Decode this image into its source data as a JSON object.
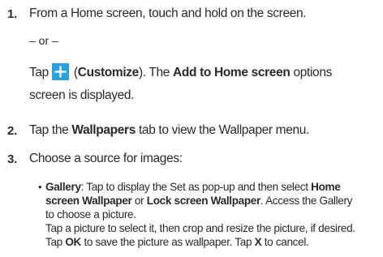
{
  "steps": [
    {
      "number": "1.",
      "line1": "From a Home screen, touch and hold on the screen.",
      "or_text": "– or –",
      "tap_prefix": "Tap",
      "icon": "plus-icon",
      "icon_color": "#2aa0dc",
      "customize_open": "(",
      "customize_label": "Customize",
      "customize_close": "). The",
      "add_to_home_label": "Add to Home screen",
      "options_text": "options",
      "line_end": "screen is displayed."
    },
    {
      "number": "2.",
      "prefix": "Tap the",
      "wallpapers_label": "Wallpapers",
      "suffix": "tab to view the Wallpaper menu."
    },
    {
      "number": "3.",
      "text": "Choose a source for images:"
    }
  ],
  "gallery": {
    "bullet": "•",
    "label": "Gallery",
    "l1_text": ": Tap to display the Set as pop-up and then select",
    "home_label_a": "Home",
    "home_label_b": "screen Wallpaper",
    "or_word": "or",
    "lock_label": "Lock screen Wallpaper",
    "l2_text": ". Access the Gallery",
    "l3": "to choose a picture.",
    "l4": "Tap a picture to select it, then crop and resize the picture, if desired.",
    "l5_a": "Tap",
    "ok_label": "OK",
    "l5_b": "to save the picture as wallpaper. Tap",
    "x_label": "X",
    "l5_c": "to cancel."
  }
}
